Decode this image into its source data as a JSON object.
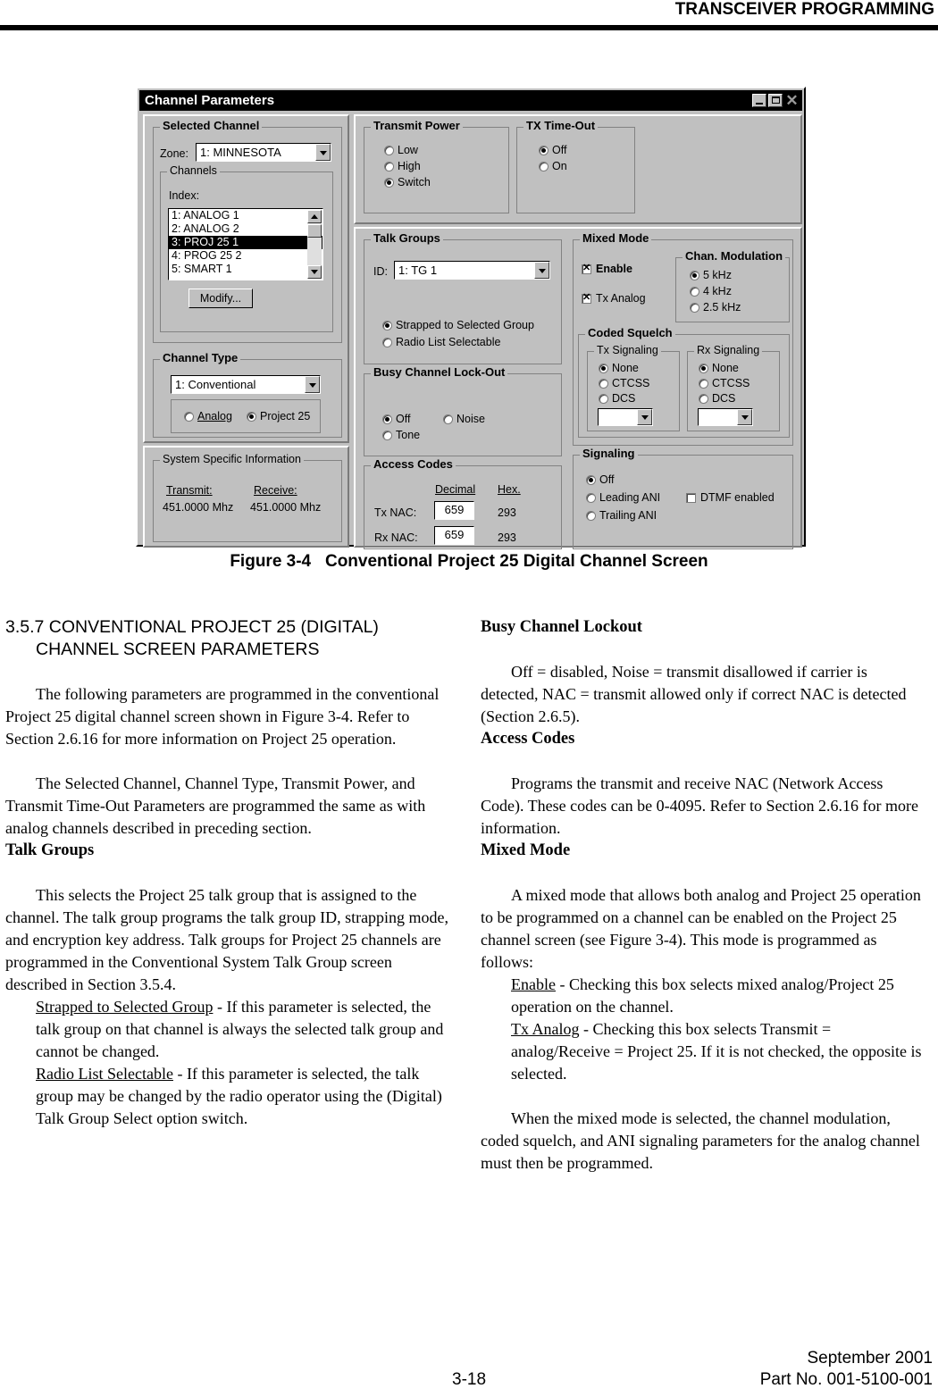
{
  "header": {
    "title": "TRANSCEIVER PROGRAMMING"
  },
  "figure": {
    "caption_number": "Figure 3-4",
    "caption_text": "Conventional Project 25 Digital Channel Screen",
    "dialog": {
      "title": "Channel Parameters",
      "window_buttons": {
        "minimize": "minimize-icon",
        "maximize": "maximize-icon",
        "close": "✕"
      },
      "selected_channel": {
        "legend": "Selected Channel",
        "zone_label": "Zone:",
        "zone_value": "1:  MINNESOTA",
        "channels_legend": "Channels",
        "index_label": "Index:",
        "items": [
          {
            "label": "1: ANALOG 1",
            "selected": false
          },
          {
            "label": "2: ANALOG 2",
            "selected": false
          },
          {
            "label": "3: PROJ 25 1",
            "selected": true
          },
          {
            "label": "4: PROG 25 2",
            "selected": false
          },
          {
            "label": "5: SMART 1",
            "selected": false
          }
        ],
        "modify_button": "Modify..."
      },
      "channel_type": {
        "legend": "Channel Type",
        "value": "1:  Conventional",
        "options": [
          {
            "label": "Analog",
            "accel": "A",
            "selected": false
          },
          {
            "label": "Project 25",
            "accel": "P",
            "selected": true
          }
        ]
      },
      "system_specific": {
        "legend": "System Specific Information",
        "transmit_label": "Transmit:",
        "receive_label": "Receive:",
        "transmit_value": "451.0000 Mhz",
        "receive_value": "451.0000 Mhz"
      },
      "transmit_power": {
        "legend": "Transmit Power",
        "legend_accel": "P",
        "options": [
          {
            "label": "Low",
            "selected": false
          },
          {
            "label": "High",
            "selected": false
          },
          {
            "label": "Switch",
            "selected": true
          }
        ]
      },
      "tx_time_out": {
        "legend": "TX Time-Out",
        "legend_accel": "O",
        "options": [
          {
            "label": "Off",
            "selected": true
          },
          {
            "label": "On",
            "selected": false
          }
        ]
      },
      "talk_groups": {
        "legend": "Talk Groups",
        "id_label": "ID:",
        "id_value": "1: TG 1",
        "options": [
          {
            "label": "Strapped to Selected Group",
            "selected": true
          },
          {
            "label": "Radio List Selectable",
            "selected": false
          }
        ]
      },
      "busy_channel_lockout": {
        "legend": "Busy Channel Lock-Out",
        "options": [
          {
            "label": "Off",
            "selected": true
          },
          {
            "label": "Noise",
            "selected": false
          },
          {
            "label": "Tone",
            "selected": false
          }
        ]
      },
      "access_codes": {
        "legend": "Access Codes",
        "col_decimal": "Decimal",
        "col_hex": "Hex.",
        "tx_label": "Tx NAC:",
        "tx_decimal": "659",
        "tx_hex": "293",
        "rx_label": "Rx NAC:",
        "rx_decimal": "659",
        "rx_hex": "293"
      },
      "mixed_mode": {
        "legend": "Mixed Mode",
        "enable_label": "Enable",
        "enable_checked": true,
        "tx_analog_label": "Tx Analog",
        "tx_analog_checked": true,
        "chan_modulation": {
          "legend": "Chan. Modulation",
          "legend_accel": "M",
          "options": [
            {
              "label": "5 kHz",
              "selected": true
            },
            {
              "label": "4 kHz",
              "selected": false
            },
            {
              "label": "2.5 kHz",
              "selected": false
            }
          ]
        },
        "coded_squelch": {
          "legend": "Coded Squelch",
          "tx_signaling": {
            "legend": "Tx Signaling",
            "options": [
              {
                "label": "None",
                "selected": true
              },
              {
                "label": "CTCSS",
                "selected": false
              },
              {
                "label": "DCS",
                "selected": false
              }
            ],
            "combo_value": ""
          },
          "rx_signaling": {
            "legend": "Rx Signaling",
            "options": [
              {
                "label": "None",
                "selected": true
              },
              {
                "label": "CTCSS",
                "selected": false
              },
              {
                "label": "DCS",
                "selected": false
              }
            ],
            "combo_value": ""
          }
        }
      },
      "signaling": {
        "legend": "Signaling",
        "legend_accel": "S",
        "options": [
          {
            "label": "Off",
            "selected": true
          },
          {
            "label": "Leading ANI",
            "selected": false
          },
          {
            "label": "Trailing ANI",
            "selected": false
          }
        ],
        "dtmf_label": "DTMF enabled",
        "dtmf_checked": false
      }
    }
  },
  "left_column": {
    "section_number_line1": "3.5.7 CONVENTIONAL PROJECT 25 (DIGITAL)",
    "section_number_line2": "CHANNEL SCREEN PARAMETERS",
    "para1": "The following parameters are programmed in the conventional Project 25 digital channel screen shown in Figure 3-4. Refer to Section 2.6.16 for more information on Project 25 operation.",
    "para2": "The Selected Channel, Channel Type, Transmit Power, and Transmit Time-Out Parameters are programmed the same as with analog channels described in preceding section.",
    "heading_talk_groups": "Talk Groups",
    "para3": "This selects the Project 25 talk group that is assigned to the channel. The talk group programs the talk group ID, strapping mode, and encryption key address. Talk groups for Project 25 channels are programmed in the Conventional System Talk Group screen described in Section 3.5.4.",
    "item1_term": "Strapped to Selected Group",
    "item1_text": " - If this parameter is selected, the talk group on that channel is always the selected talk group and cannot be changed.",
    "item2_term": "Radio List Selectable",
    "item2_text": " - If this parameter is selected, the talk group may be changed by the radio operator using the (Digital) Talk Group Select option switch."
  },
  "right_column": {
    "heading_busy": "Busy Channel Lockout",
    "para1": "Off = disabled, Noise = transmit disallowed if carrier is detected, NAC = transmit allowed only if correct NAC is detected (Section 2.6.5).",
    "heading_access": "Access Codes",
    "para2": "Programs the transmit and receive NAC (Network Access Code). These codes can be 0-4095. Refer to Section 2.6.16 for more information.",
    "heading_mixed": "Mixed Mode",
    "para3": "A mixed mode that allows both analog and Project 25 operation to be programmed on a channel can be enabled on the Project 25 channel screen (see Figure 3-4). This mode is programmed as follows:",
    "item1_term": "Enable",
    "item1_text": " - Checking this box selects mixed analog/Project 25 operation on the channel.",
    "item2_term": "Tx Analog",
    "item2_text": " - Checking this box selects Transmit = analog/Receive = Project 25. If it is not checked, the opposite is selected.",
    "para4": "When the mixed mode is selected, the channel modulation, coded squelch, and ANI signaling parameters for the analog channel must then be programmed."
  },
  "footer": {
    "page_number": "3-18",
    "date": "September 2001",
    "part_no": "Part No. 001-5100-001"
  }
}
